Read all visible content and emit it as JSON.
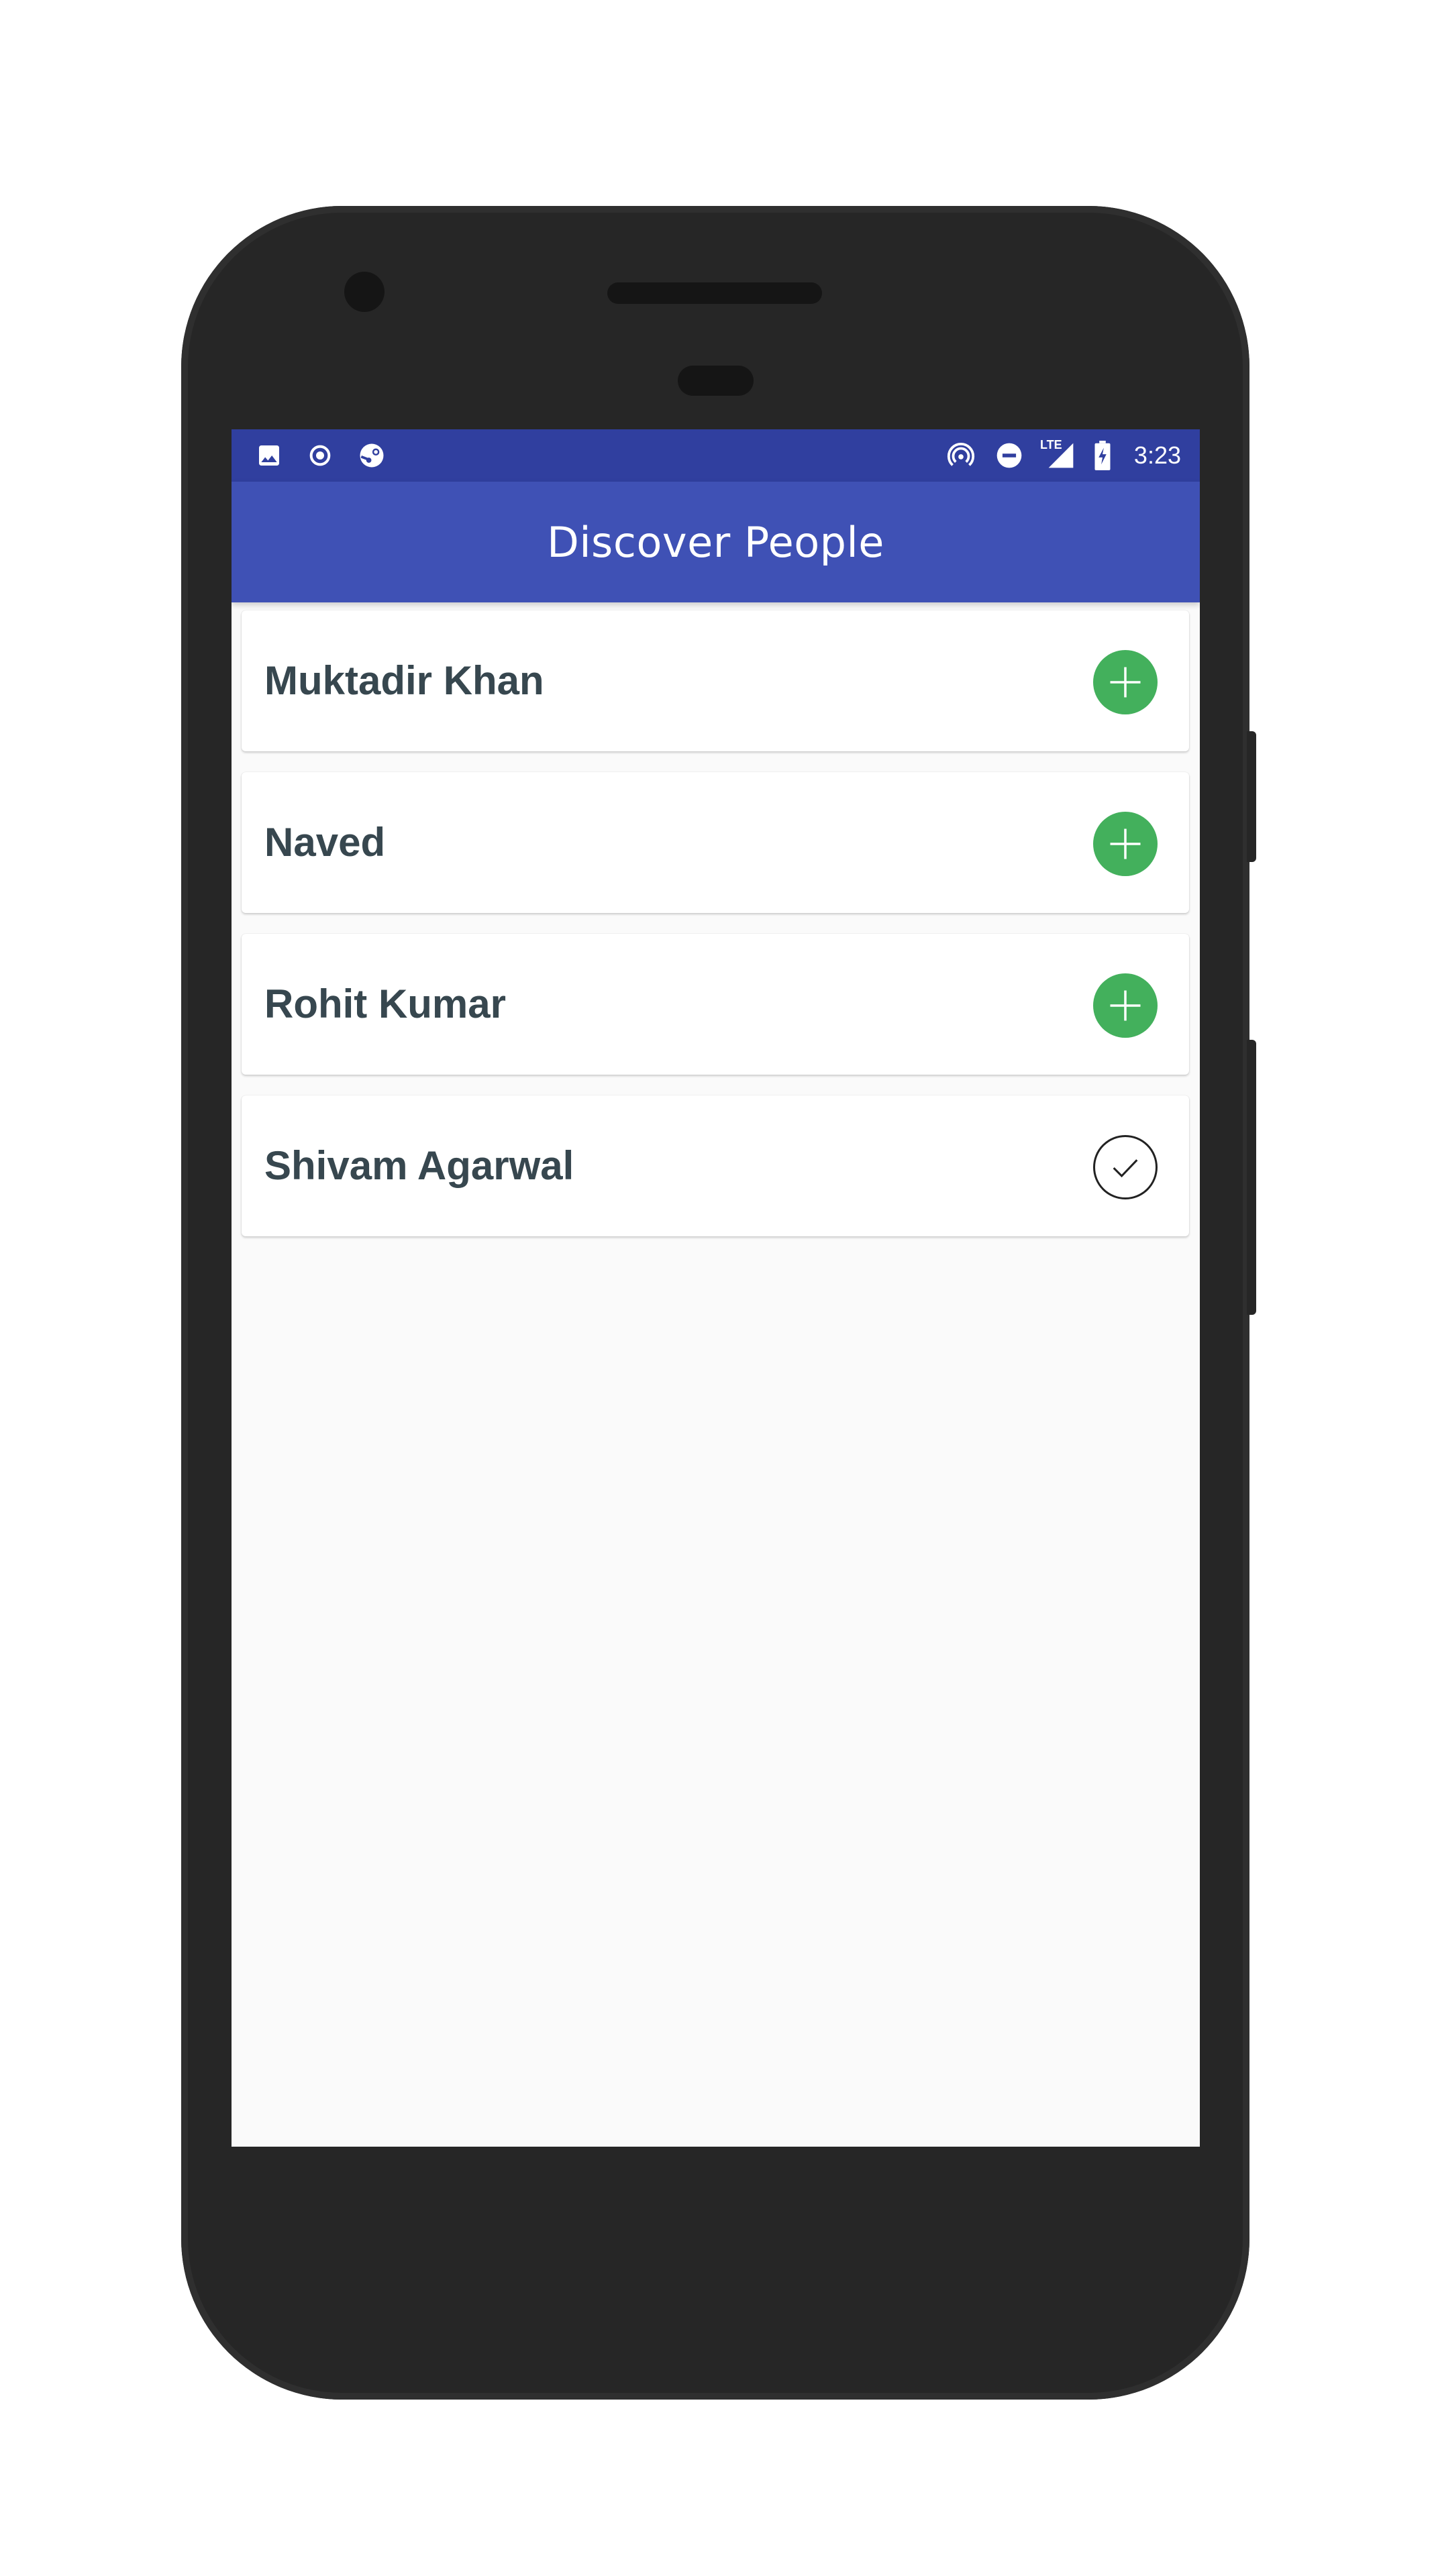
{
  "status_bar": {
    "time": "3:23",
    "network_label": "LTE",
    "left_icons": [
      "image-icon",
      "record-icon",
      "steam-icon"
    ],
    "right_icons": [
      "hotspot-icon",
      "do-not-disturb-icon",
      "signal-icon",
      "battery-charging-icon"
    ]
  },
  "app_bar": {
    "title": "Discover People"
  },
  "people": [
    {
      "name": "Muktadir Khan",
      "action_icon": "add-icon",
      "status": "not-followed"
    },
    {
      "name": "Naved",
      "action_icon": "add-icon",
      "status": "not-followed"
    },
    {
      "name": "Rohit Kumar",
      "action_icon": "add-icon",
      "status": "not-followed"
    },
    {
      "name": "Shivam Agarwal",
      "action_icon": "check-icon",
      "status": "followed"
    }
  ],
  "colors": {
    "status_bar": "#303f9f",
    "app_bar": "#3f51b5",
    "add_button": "#43b05c",
    "name_text": "#37474f",
    "screen_bg": "#fafafa"
  }
}
